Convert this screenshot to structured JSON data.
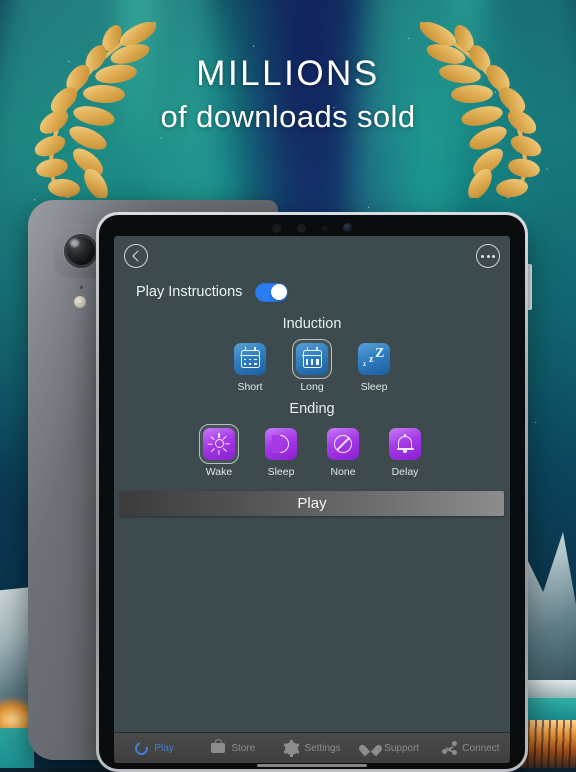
{
  "banner": {
    "headline": "MILLIONS",
    "subline": "of downloads sold",
    "laurel_icon": "laurel-wreath-icon"
  },
  "app": {
    "nav": {
      "back_icon": "chevron-left-icon",
      "back_label": "Back",
      "more_icon": "more-horizontal-icon",
      "more_label": "More"
    },
    "play_instructions": {
      "label": "Play Instructions",
      "toggle_state": "on",
      "toggle_color": "#2a7cf0"
    },
    "induction": {
      "title": "Induction",
      "selected": "Long",
      "accent_color": "#2f7ec2",
      "options": [
        {
          "label": "Short",
          "icon": "calendar-short-icon",
          "selected": false
        },
        {
          "label": "Long",
          "icon": "calendar-long-icon",
          "selected": true
        },
        {
          "label": "Sleep",
          "icon": "zzz-sleep-icon",
          "selected": false
        }
      ]
    },
    "ending": {
      "title": "Ending",
      "selected": "Wake",
      "accent_color": "#a63ae8",
      "options": [
        {
          "label": "Wake",
          "icon": "sun-icon",
          "selected": true
        },
        {
          "label": "Sleep",
          "icon": "moon-icon",
          "selected": false
        },
        {
          "label": "None",
          "icon": "circle-slash-icon",
          "selected": false
        },
        {
          "label": "Delay",
          "icon": "bell-icon",
          "selected": false
        }
      ]
    },
    "play_button": {
      "label": "Play"
    },
    "tabbar": {
      "active": "Play",
      "items": [
        {
          "label": "Play",
          "icon": "play-ring-icon",
          "active": true
        },
        {
          "label": "Store",
          "icon": "bag-icon",
          "active": false
        },
        {
          "label": "Settings",
          "icon": "gear-icon",
          "active": false
        },
        {
          "label": "Support",
          "icon": "heart-icon",
          "active": false
        },
        {
          "label": "Connect",
          "icon": "share-icon",
          "active": false
        }
      ]
    }
  },
  "devices": {
    "back_tablet": {
      "name": "tablet-rear-view",
      "camera_icon": "camera-lens-icon",
      "flash_icon": "flash-icon"
    },
    "front_tablet": {
      "name": "tablet-front-view",
      "volume_button_label": "Volume"
    }
  }
}
